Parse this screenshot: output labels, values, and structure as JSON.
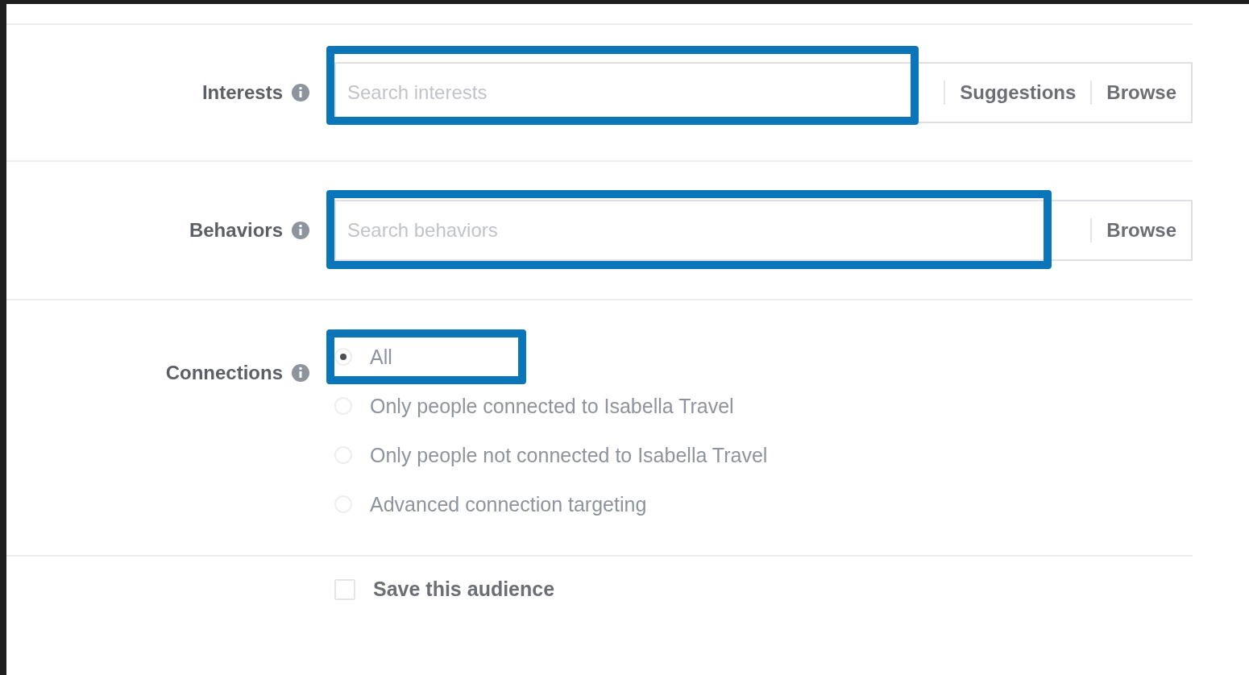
{
  "fields": [
    {
      "label": "Interests",
      "placeholder": "Search interests",
      "actions": [
        "Suggestions",
        "Browse"
      ],
      "highlighted": true
    },
    {
      "label": "Behaviors",
      "placeholder": "Search behaviors",
      "actions": [
        "Browse"
      ],
      "highlighted": true
    }
  ],
  "connections": {
    "label": "Connections",
    "options": [
      {
        "label": "All",
        "selected": true,
        "highlighted": true
      },
      {
        "label": "Only people connected to Isabella Travel",
        "selected": false,
        "highlighted": false
      },
      {
        "label": "Only people not connected to Isabella Travel",
        "selected": false,
        "highlighted": false
      },
      {
        "label": "Advanced connection targeting",
        "selected": false,
        "highlighted": false
      }
    ]
  },
  "save": {
    "label": "Save this audience",
    "checked": false
  }
}
